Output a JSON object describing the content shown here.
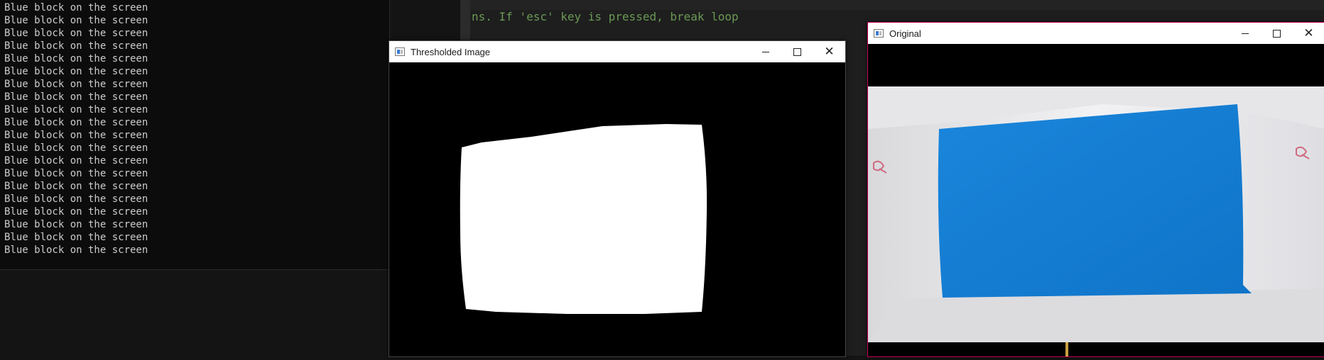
{
  "console": {
    "lines": [
      "Blue block on the screen",
      "Blue block on the screen",
      "Blue block on the screen",
      "Blue block on the screen",
      "Blue block on the screen",
      "Blue block on the screen",
      "Blue block on the screen",
      "Blue block on the screen",
      "Blue block on the screen",
      "Blue block on the screen",
      "Blue block on the screen",
      "Blue block on the screen",
      "Blue block on the screen",
      "Blue block on the screen",
      "Blue block on the screen",
      "Blue block on the screen",
      "Blue block on the screen",
      "Blue block on the screen",
      "Blue block on the screen",
      "Blue block on the screen"
    ]
  },
  "editor": {
    "comment_fragment": "ns. If 'esc' key is pressed, break loop"
  },
  "windows": {
    "thresholded": {
      "title": "Thresholded Image"
    },
    "original": {
      "title": "Original"
    }
  },
  "colors": {
    "detected_block": "#1480d6",
    "background_paper": "#e8e8ea",
    "mask_white": "#ffffff",
    "original_border": "#c7005a"
  }
}
